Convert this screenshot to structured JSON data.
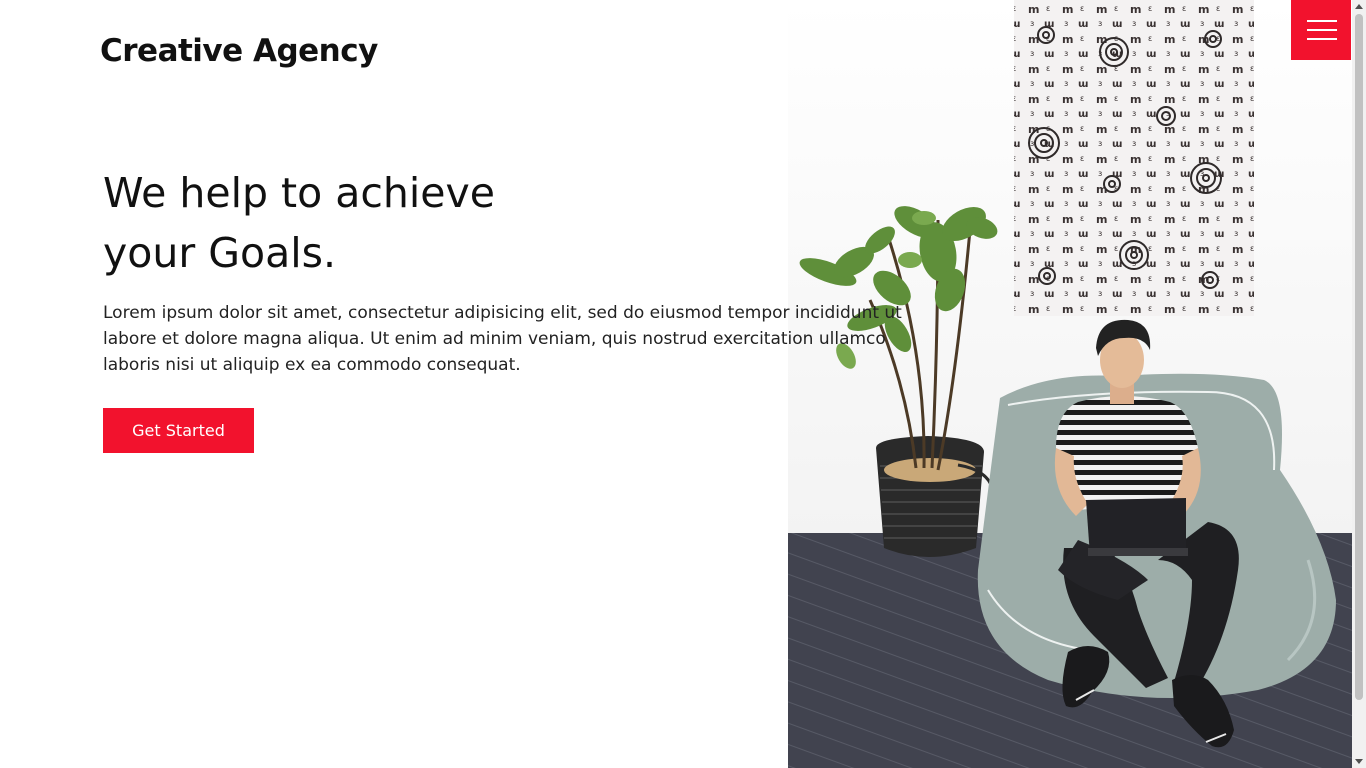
{
  "brand": {
    "logo_text": "Creative Agency"
  },
  "hero": {
    "title_line1": "We help to achieve",
    "title_line2": "your Goals.",
    "description": "Lorem ipsum dolor sit amet, consectetur adipisicing elit, sed do eiusmod tempor incididunt ut labore et dolore magna aliqua. Ut enim ad minim veniam, quis nostrud exercitation ullamco laboris nisi ut aliquip ex ea commodo consequat.",
    "cta_label": "Get Started"
  },
  "nav": {
    "menu_icon": "hamburger-menu-icon"
  },
  "colors": {
    "accent": "#f2122d",
    "text": "#111111",
    "floor": "#3f4250",
    "beanbag": "#9aaaa6"
  }
}
